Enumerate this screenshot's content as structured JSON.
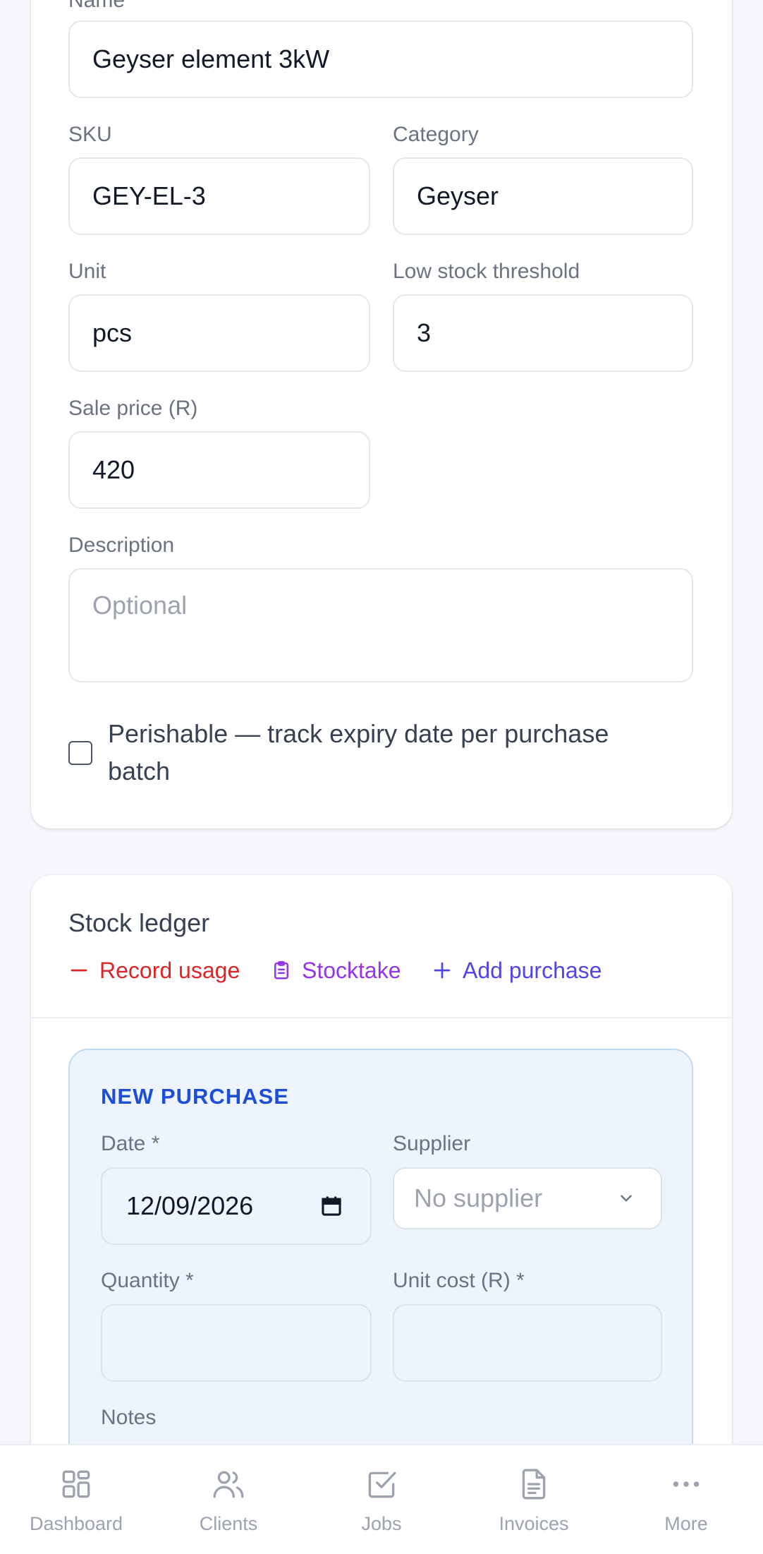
{
  "item_form": {
    "name_label": "Name",
    "name_value": "Geyser element 3kW",
    "sku_label": "SKU",
    "sku_value": "GEY-EL-3",
    "category_label": "Category",
    "category_value": "Geyser",
    "unit_label": "Unit",
    "unit_value": "pcs",
    "threshold_label": "Low stock threshold",
    "threshold_value": "3",
    "price_label": "Sale price (R)",
    "price_value": "420",
    "description_label": "Description",
    "description_placeholder": "Optional",
    "perishable_label_line1": "Perishable — track expiry date per purchase",
    "perishable_label_line2": "batch"
  },
  "ledger": {
    "title": "Stock ledger",
    "actions": {
      "record_usage": "Record usage",
      "stocktake": "Stocktake",
      "add_purchase": "Add purchase"
    },
    "colors": {
      "record_usage": "#dc2626",
      "stocktake": "#9333ea",
      "add_purchase": "#4f46e5"
    }
  },
  "new_purchase": {
    "heading": "NEW PURCHASE",
    "date_label": "Date *",
    "date_value": "12/09/2026",
    "supplier_label": "Supplier",
    "supplier_value": "No supplier",
    "quantity_label": "Quantity *",
    "unit_cost_label": "Unit cost (R) *",
    "notes_label": "Notes"
  },
  "bottom_nav": {
    "items": [
      {
        "label": "Dashboard",
        "icon": "dashboard-icon"
      },
      {
        "label": "Clients",
        "icon": "users-icon"
      },
      {
        "label": "Jobs",
        "icon": "check-square-icon"
      },
      {
        "label": "Invoices",
        "icon": "document-icon"
      },
      {
        "label": "More",
        "icon": "more-dots-icon"
      }
    ]
  }
}
